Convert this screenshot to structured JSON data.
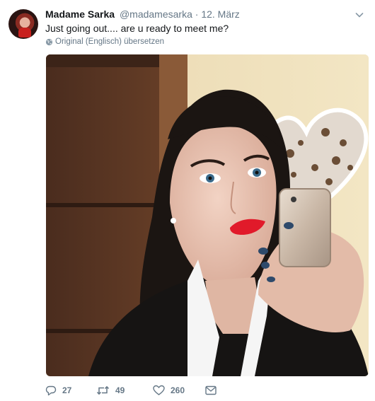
{
  "tweet": {
    "author_name": "Madame Sarka",
    "handle": "@madamesarka",
    "separator": "·",
    "date": "12. März",
    "text": "Just going out.... are u ready to meet me?",
    "translate_label": "Original (Englisch) übersetzen"
  },
  "actions": {
    "replies": "27",
    "retweets": "49",
    "likes": "260"
  },
  "icons": {
    "caret": "chevron-down-icon",
    "globe": "globe-icon",
    "reply": "reply-icon",
    "retweet": "retweet-icon",
    "like": "heart-icon",
    "dm": "envelope-icon"
  },
  "colors": {
    "text": "#14171a",
    "secondary": "#657786"
  }
}
